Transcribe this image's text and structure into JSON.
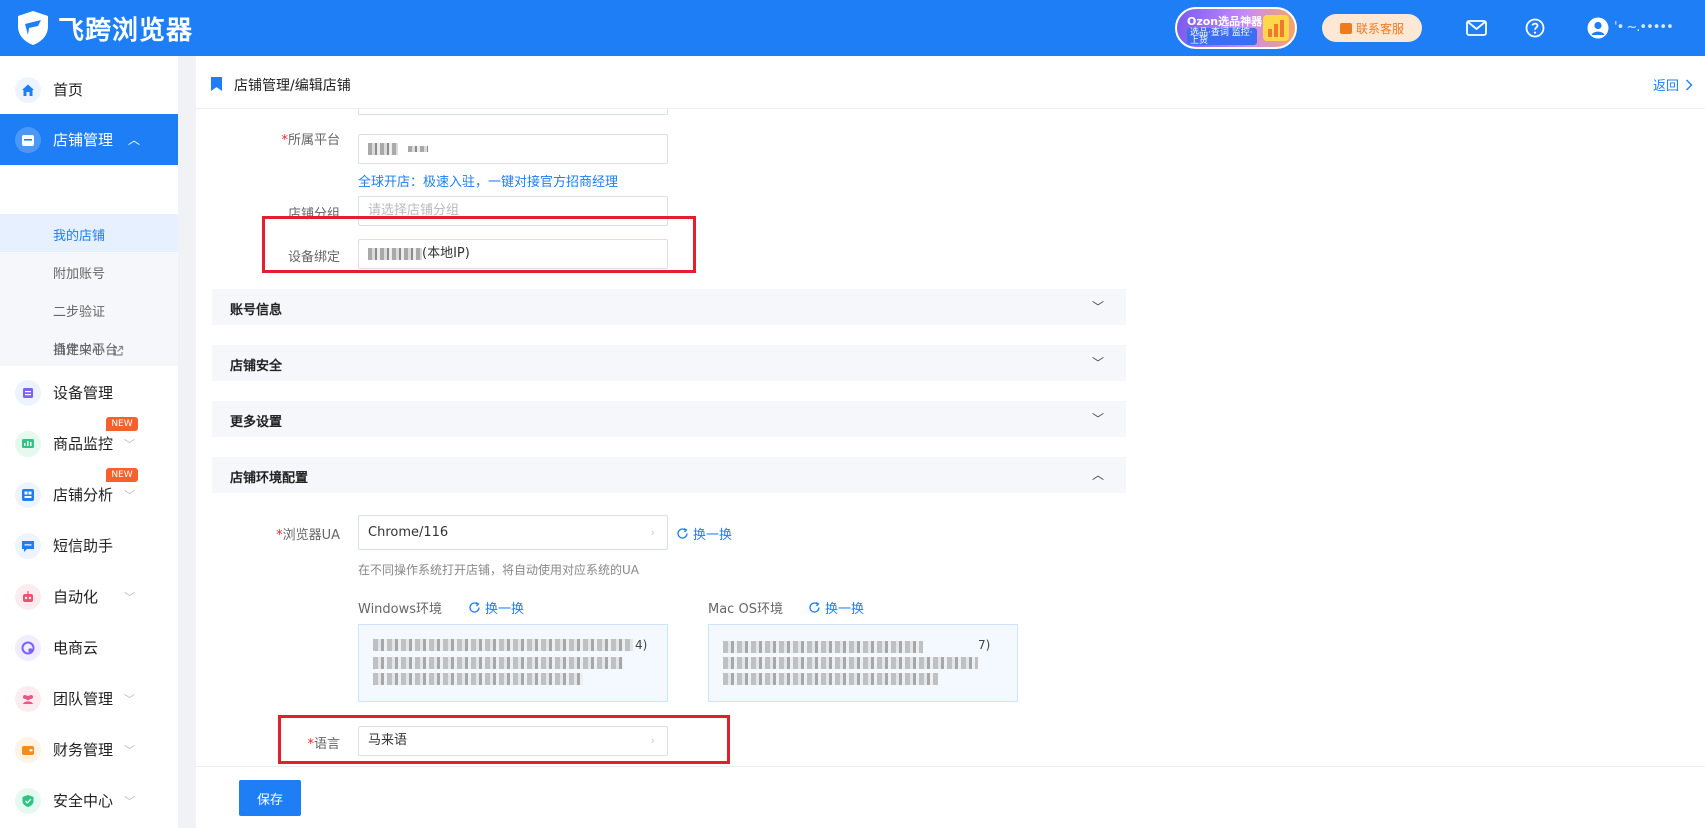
{
  "app": {
    "name": "飞跨浏览器"
  },
  "header": {
    "promo": {
      "title": "Ozon选品神器",
      "tags": "选品·查词 监控·上货"
    },
    "service_label": "联系客服",
    "user_name": "'• ~.•••••"
  },
  "sidebar": {
    "items": [
      {
        "label": "首页"
      },
      {
        "label": "店铺管理"
      },
      {
        "label": "设备管理"
      },
      {
        "label": "商品监控",
        "badge": "NEW"
      },
      {
        "label": "店铺分析",
        "badge": "NEW"
      },
      {
        "label": "短信助手"
      },
      {
        "label": "自动化"
      },
      {
        "label": "电商云"
      },
      {
        "label": "团队管理"
      },
      {
        "label": "财务管理"
      },
      {
        "label": "安全中心"
      }
    ],
    "sub_items": [
      {
        "label": "我的店铺"
      },
      {
        "label": "附加账号"
      },
      {
        "label": "二步验证"
      },
      {
        "label": "插件中心"
      },
      {
        "label": "自定义平台"
      }
    ]
  },
  "main": {
    "breadcrumb": "店铺管理/编辑店铺",
    "back_label": "返回",
    "form": {
      "platform_label": "所属平台",
      "platform_hint": "全球开店：极速入驻，一键对接官方招商经理",
      "group_label": "店铺分组",
      "group_placeholder": "请选择店铺分组",
      "device_label": "设备绑定",
      "device_value": "(本地IP)"
    },
    "sections": [
      {
        "title": "账号信息",
        "state": "collapsed"
      },
      {
        "title": "店铺安全",
        "state": "collapsed"
      },
      {
        "title": "更多设置",
        "state": "collapsed"
      },
      {
        "title": "店铺环境配置",
        "state": "expanded"
      }
    ],
    "env": {
      "ua_label": "浏览器UA",
      "ua_value": "Chrome/116",
      "swap_label": "换一换",
      "ua_hint": "在不同操作系统打开店铺，将自动使用对应系统的UA",
      "windows_label": "Windows环境",
      "mac_label": "Mac OS环境",
      "windows_ua_tail": "4)",
      "mac_ua_tail": "7)",
      "language_label": "语言",
      "language_value": "马来语"
    },
    "save_label": "保存"
  },
  "colors": {
    "primary": "#1e7ef5",
    "highlight": "#e41f2b",
    "badge": "#f5602c"
  }
}
